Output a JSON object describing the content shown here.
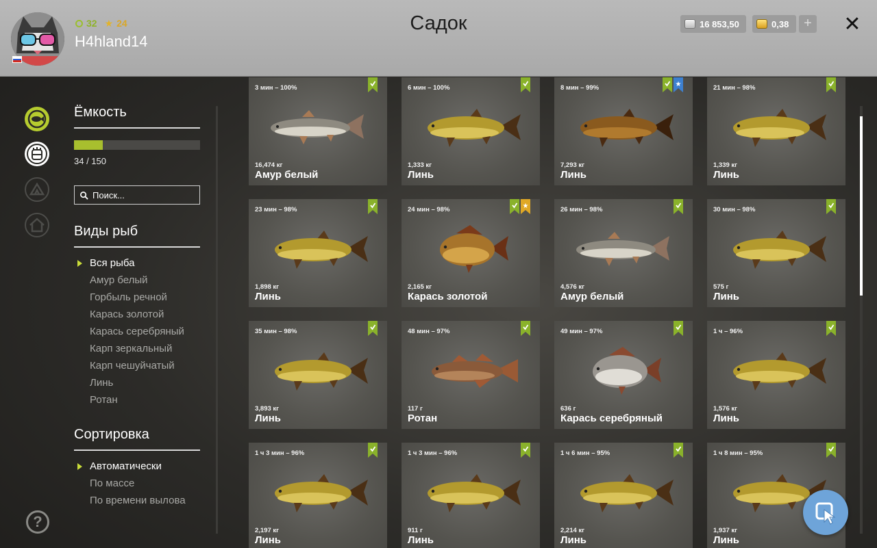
{
  "header": {
    "title": "Садок",
    "username": "H4hland14",
    "level": "32",
    "stars": "24",
    "silver": "16 853,50",
    "gold": "0,38",
    "add_label": "+",
    "close_label": "✕"
  },
  "sidebar": {
    "capacity_title": "Ёмкость",
    "capacity_count": "34 / 150",
    "capacity_fraction": 0.227,
    "search_placeholder": "Поиск...",
    "species_title": "Виды рыб",
    "species": [
      "Вся рыба",
      "Амур белый",
      "Горбыль речной",
      "Карась золотой",
      "Карась серебряный",
      "Карп зеркальный",
      "Карп чешуйчатый",
      "Линь",
      "Ротан"
    ],
    "species_active": 0,
    "sort_title": "Сортировка",
    "sort": [
      "Автоматически",
      "По массе",
      "По времени вылова"
    ],
    "sort_active": 0,
    "help_label": "?"
  },
  "colors": {
    "accent": "#b6cc2f",
    "badge_green": "#8ab22b",
    "badge_blue": "#3d80d0",
    "badge_gold": "#e0a825",
    "fab": "#6ea4d9"
  },
  "fish": [
    {
      "time": "3 мин – 100%",
      "weight": "16,474 кг",
      "name": "Амур белый",
      "type": "amur",
      "badges": [
        "green"
      ]
    },
    {
      "time": "6 мин – 100%",
      "weight": "1,333 кг",
      "name": "Линь",
      "type": "tench",
      "badges": [
        "green"
      ]
    },
    {
      "time": "8 мин – 99%",
      "weight": "7,293 кг",
      "name": "Линь",
      "type": "tench-dark",
      "badges": [
        "green",
        "blue"
      ]
    },
    {
      "time": "21 мин – 98%",
      "weight": "1,339 кг",
      "name": "Линь",
      "type": "tench",
      "badges": [
        "green"
      ]
    },
    {
      "time": "23 мин – 98%",
      "weight": "1,898 кг",
      "name": "Линь",
      "type": "tench",
      "badges": [
        "green"
      ]
    },
    {
      "time": "24 мин – 98%",
      "weight": "2,165 кг",
      "name": "Карась золотой",
      "type": "crucian-gold",
      "badges": [
        "green",
        "gold"
      ]
    },
    {
      "time": "26 мин – 98%",
      "weight": "4,576 кг",
      "name": "Амур белый",
      "type": "amur",
      "badges": [
        "green"
      ]
    },
    {
      "time": "30 мин – 98%",
      "weight": "575 г",
      "name": "Линь",
      "type": "tench",
      "badges": [
        "green"
      ]
    },
    {
      "time": "35 мин – 98%",
      "weight": "3,893 кг",
      "name": "Линь",
      "type": "tench",
      "badges": [
        "green"
      ]
    },
    {
      "time": "48 мин – 97%",
      "weight": "117 г",
      "name": "Ротан",
      "type": "rotan",
      "badges": [
        "green"
      ]
    },
    {
      "time": "49 мин – 97%",
      "weight": "636 г",
      "name": "Карась серебряный",
      "type": "crucian-silver",
      "badges": [
        "green"
      ]
    },
    {
      "time": "1 ч – 96%",
      "weight": "1,576 кг",
      "name": "Линь",
      "type": "tench",
      "badges": [
        "green"
      ]
    },
    {
      "time": "1 ч 3 мин – 96%",
      "weight": "2,197 кг",
      "name": "Линь",
      "type": "tench",
      "badges": [
        "green"
      ]
    },
    {
      "time": "1 ч 3 мин – 96%",
      "weight": "911 г",
      "name": "Линь",
      "type": "tench",
      "badges": [
        "green"
      ]
    },
    {
      "time": "1 ч 6 мин – 95%",
      "weight": "2,214 кг",
      "name": "Линь",
      "type": "tench",
      "badges": [
        "green"
      ]
    },
    {
      "time": "1 ч 8 мин – 95%",
      "weight": "1,937 кг",
      "name": "Линь",
      "type": "tench",
      "badges": [
        "green"
      ]
    }
  ]
}
